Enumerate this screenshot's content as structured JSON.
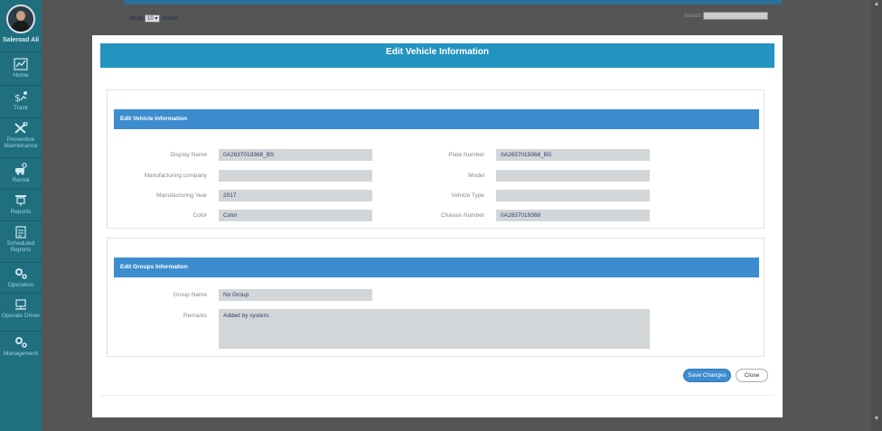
{
  "user": {
    "name": "Saleroad Ali"
  },
  "sidebar": {
    "items": [
      {
        "label": "Home",
        "icon": "chart-icon"
      },
      {
        "label": "Track",
        "icon": "track-icon"
      },
      {
        "label": "Preventive Maintenance",
        "icon": "tools-icon"
      },
      {
        "label": "Rental",
        "icon": "rental-icon"
      },
      {
        "label": "Reports",
        "icon": "reports-icon"
      },
      {
        "label": "Scheduled Reports",
        "icon": "scheduled-reports-icon"
      },
      {
        "label": "Operation",
        "icon": "gears-icon"
      },
      {
        "label": "Operate Driver",
        "icon": "driver-icon"
      },
      {
        "label": "Management",
        "icon": "gears-icon"
      }
    ]
  },
  "background": {
    "show_prefix": "Show",
    "show_value": "10",
    "show_suffix": "entries",
    "search_label": "Search:"
  },
  "modal": {
    "title": "Edit Vehicle Information",
    "vehicle_section": {
      "title": "Edit Vehicle Information",
      "display_name": {
        "label": "Display Name",
        "value": "0A2637019368_BS"
      },
      "plate_number": {
        "label": "Plate Number",
        "value": "0A2637019368_BS"
      },
      "manufacturing_company": {
        "label": "Manufacturing company",
        "value": ""
      },
      "model": {
        "label": "Model",
        "value": ""
      },
      "manufacturing_year": {
        "label": "Manufacturing Year",
        "value": "2017"
      },
      "vehicle_type": {
        "label": "Vehicle Type",
        "value": ""
      },
      "color": {
        "label": "Color",
        "value": "Color"
      },
      "chassis_number": {
        "label": "Chassis Number",
        "value": "0A2637019368"
      }
    },
    "groups_section": {
      "title": "Edit Groups Information",
      "group_name": {
        "label": "Group Name",
        "value": "No Group"
      },
      "remarks": {
        "label": "Remarks",
        "value": "Added by system."
      }
    },
    "buttons": {
      "save": "Save Changes",
      "close": "Close"
    }
  },
  "colors": {
    "sidebar": "#1f6f7f",
    "header": "#2393c0",
    "section_header": "#3d8ccf",
    "field_bg": "#d3d6d9"
  }
}
